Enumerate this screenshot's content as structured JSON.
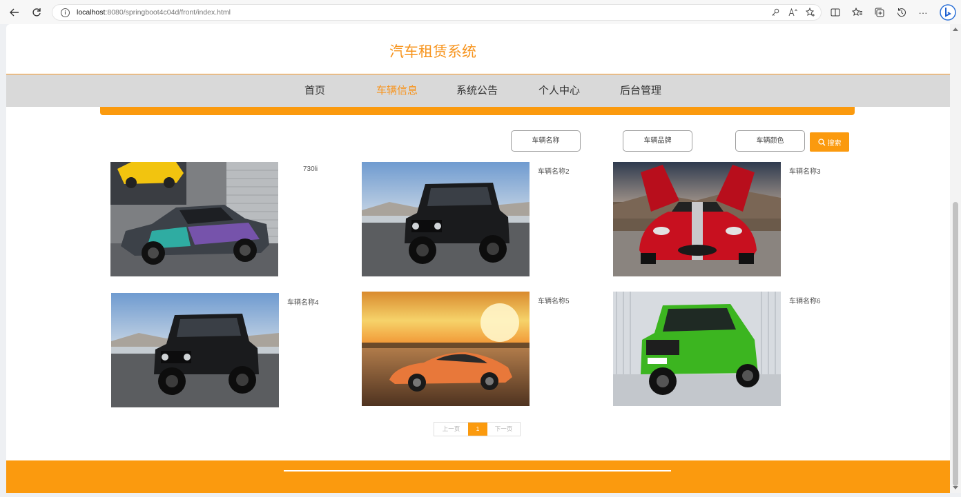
{
  "browser": {
    "url_host": "localhost",
    "url_rest": ":8080/springboot4c04d/front/index.html",
    "info_glyph": "i",
    "more_glyph": "···",
    "icons": [
      "back-icon",
      "reload-icon",
      "site-info-icon",
      "password-key-icon",
      "read-aloud-icon",
      "add-favorite-icon",
      "split-screen-icon",
      "favorites-icon",
      "collections-icon",
      "history-icon",
      "more-icon",
      "bing-icon"
    ]
  },
  "site": {
    "title": "汽车租赁系统"
  },
  "nav": {
    "items": [
      {
        "label": "首页",
        "active": false
      },
      {
        "label": "车辆信息",
        "active": true
      },
      {
        "label": "系统公告",
        "active": false
      },
      {
        "label": "个人中心",
        "active": false
      },
      {
        "label": "后台管理",
        "active": false
      }
    ]
  },
  "search": {
    "name_placeholder": "车辆名称",
    "brand_placeholder": "车辆品牌",
    "color_placeholder": "车辆颜色",
    "button_label": "搜索"
  },
  "vehicles": [
    {
      "name": "730li"
    },
    {
      "name": "车辆名称2"
    },
    {
      "name": "车辆名称3"
    },
    {
      "name": "车辆名称4"
    },
    {
      "name": "车辆名称5"
    },
    {
      "name": "车辆名称6"
    }
  ],
  "pagination": {
    "prev": "上一页",
    "current": "1",
    "next": "下一页"
  },
  "colors": {
    "accent": "#fb9a0e",
    "title": "#f7941d",
    "nav_bg": "#d9d9d9"
  }
}
